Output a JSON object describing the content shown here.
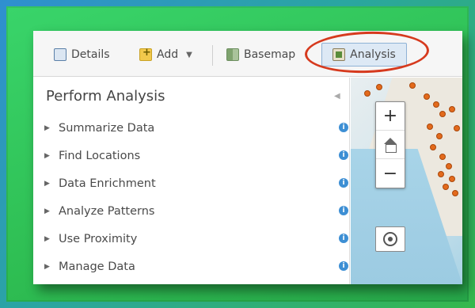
{
  "toolbar": {
    "details_label": "Details",
    "add_label": "Add",
    "basemap_label": "Basemap",
    "analysis_label": "Analysis"
  },
  "panel": {
    "title": "Perform Analysis",
    "items": [
      {
        "label": "Summarize Data"
      },
      {
        "label": "Find Locations"
      },
      {
        "label": "Data Enrichment"
      },
      {
        "label": "Analyze Patterns"
      },
      {
        "label": "Use Proximity"
      },
      {
        "label": "Manage Data"
      }
    ]
  },
  "map": {
    "zoom_in_label": "+",
    "zoom_out_label": "−"
  },
  "colors": {
    "highlight_ring": "#d63a1e",
    "info_icon": "#3d8fd4",
    "map_marker": "#e36a1c"
  }
}
